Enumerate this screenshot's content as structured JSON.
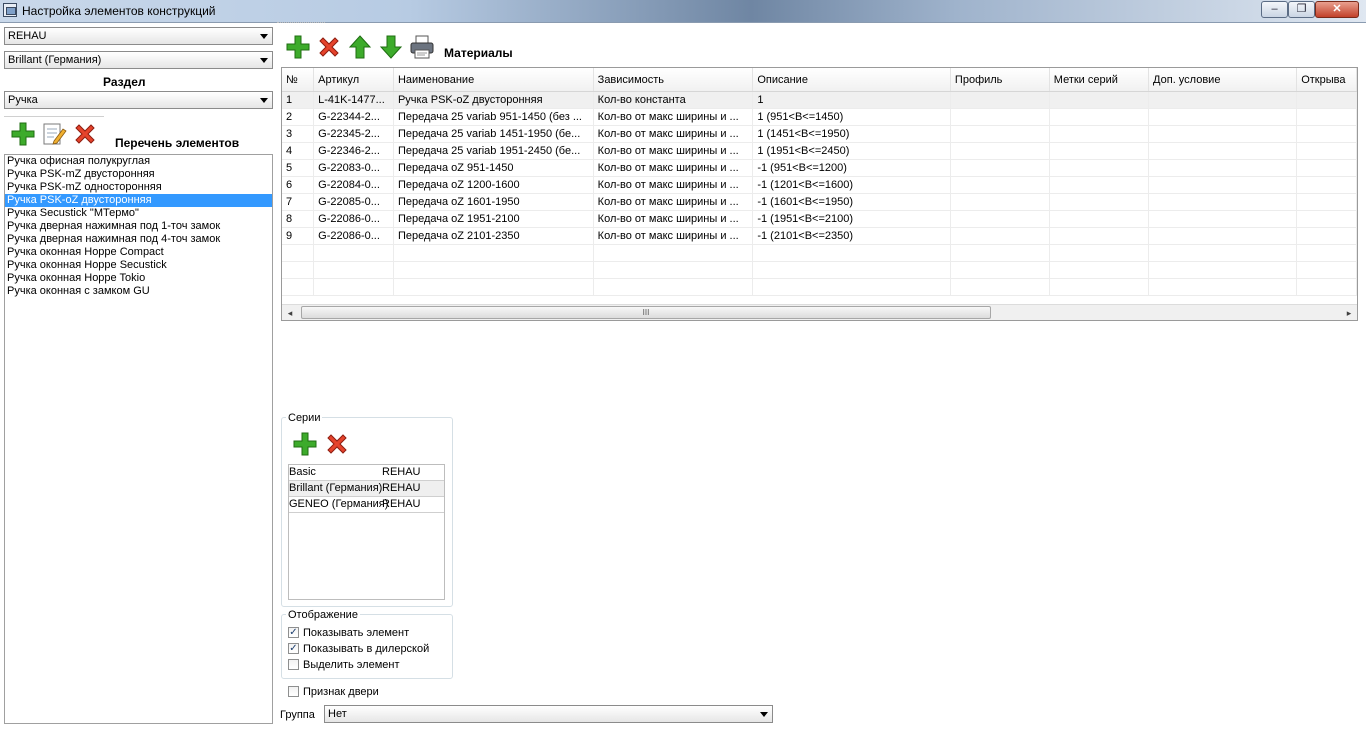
{
  "window": {
    "title": "Настройка элементов конструкций",
    "minimize_glyph": "–",
    "maximize_glyph": "❐",
    "close_glyph": "✕"
  },
  "left": {
    "system_combo": "REHAU",
    "profile_combo": "Brillant (Германия)",
    "section_label": "Раздел",
    "section_combo": "Ручка",
    "elements_label": "Перечень элементов",
    "toolbar_icons": [
      "add-icon",
      "edit-icon",
      "delete-icon"
    ],
    "elements": [
      "Ручка офисная полукруглая",
      "Ручка PSK-mZ двусторонняя",
      "Ручка PSK-mZ односторонняя",
      "Ручка PSK-oZ двусторонняя",
      "Ручка Secustick \"MТермо\"",
      "Ручка дверная нажимная под 1-точ замок",
      "Ручка дверная нажимная под 4-точ замок",
      "Ручка оконная Hoppe Compact",
      "Ручка оконная Hoppe Secustick",
      "Ручка оконная Hoppe Tokio",
      "Ручка оконная с замком GU"
    ],
    "selected_index": 3
  },
  "materials": {
    "label": "Материалы",
    "toolbar_icons": [
      "add-icon",
      "delete-icon",
      "move-up-icon",
      "move-down-icon",
      "print-icon"
    ],
    "columns": [
      "№",
      "Артикул",
      "Наименование",
      "Зависимость",
      "Описание",
      "Профиль",
      "Метки серий",
      "Доп. условие",
      "Открыва"
    ],
    "rows": [
      [
        "1",
        "L-41K-1477...",
        "Ручка PSK-oZ двусторонняя",
        "Кол-во константа",
        "1"
      ],
      [
        "2",
        "G-22344-2...",
        "Передача 25 variab 951-1450 (без ...",
        "Кол-во от макс ширины и ...",
        "1 (951<B<=1450)"
      ],
      [
        "3",
        "G-22345-2...",
        "Передача 25 variab 1451-1950 (бе...",
        "Кол-во от макс ширины и ...",
        "1 (1451<B<=1950)"
      ],
      [
        "4",
        "G-22346-2...",
        "Передача 25 variab 1951-2450 (бе...",
        "Кол-во от макс ширины и ...",
        "1 (1951<B<=2450)"
      ],
      [
        "5",
        "G-22083-0...",
        "Передача oZ 951-1450",
        "Кол-во от макс ширины и ...",
        "-1 (951<B<=1200)"
      ],
      [
        "6",
        "G-22084-0...",
        "Передача oZ 1200-1600",
        "Кол-во от макс ширины и ...",
        "-1 (1201<B<=1600)"
      ],
      [
        "7",
        "G-22085-0...",
        "Передача oZ 1601-1950",
        "Кол-во от макс ширины и ...",
        "-1 (1601<B<=1950)"
      ],
      [
        "8",
        "G-22086-0...",
        "Передача oZ 1951-2100",
        "Кол-во от макс ширины и ...",
        "-1 (1951<B<=2100)"
      ],
      [
        "9",
        "G-22086-0...",
        "Передача oZ 2101-2350",
        "Кол-во от макс ширины и ...",
        "-1 (2101<B<=2350)"
      ]
    ],
    "scroll_left": "◂",
    "scroll_right": "▸",
    "scroll_grip": "III"
  },
  "series": {
    "title": "Серии",
    "toolbar_icons": [
      "add-icon",
      "delete-icon"
    ],
    "rows": [
      {
        "name": "Basic",
        "brand": "REHAU"
      },
      {
        "name": "Brillant (Германия)",
        "brand": "REHAU"
      },
      {
        "name": "GENEO (Германия)",
        "brand": "REHAU"
      }
    ]
  },
  "display": {
    "title": "Отображение",
    "options": [
      {
        "label": "Показывать элемент",
        "checked": true
      },
      {
        "label": "Показывать в дилерской",
        "checked": true
      },
      {
        "label": "Выделить элемент",
        "checked": false
      }
    ]
  },
  "door_flag": {
    "label": "Признак двери",
    "checked": false
  },
  "group": {
    "label": "Группа",
    "value": "Нет"
  },
  "check_glyph": "✓"
}
